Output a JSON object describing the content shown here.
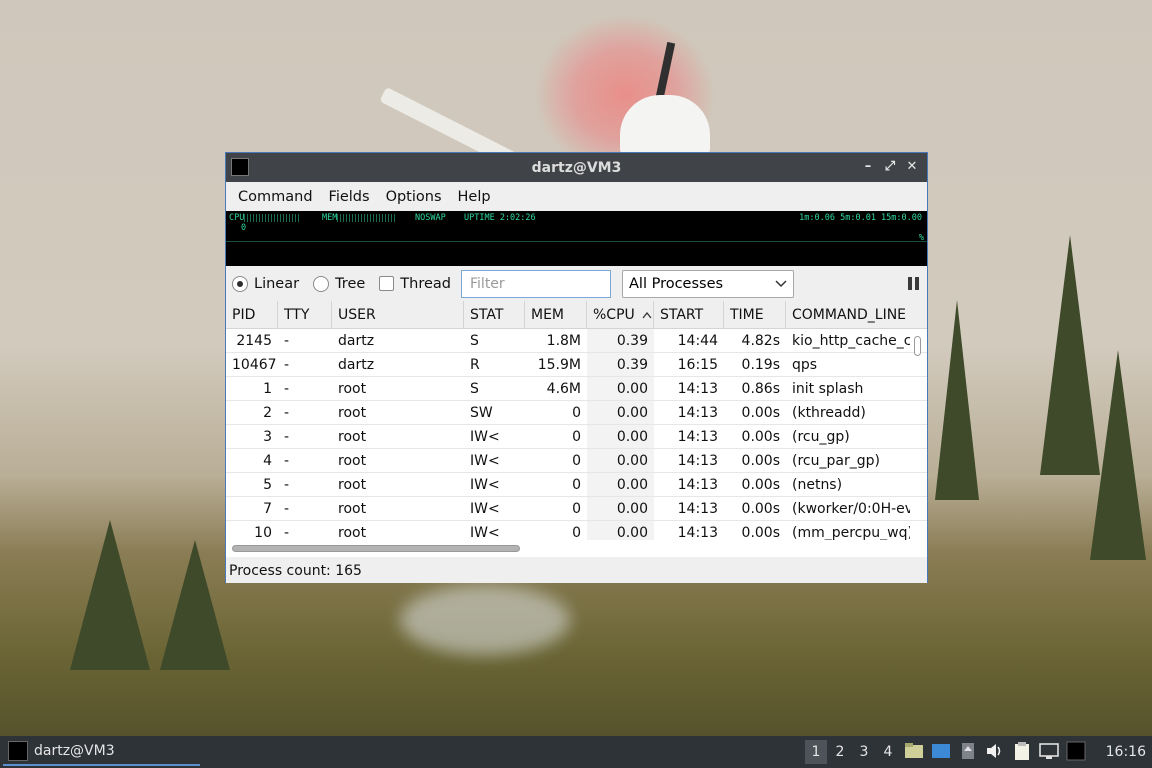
{
  "window": {
    "title": "dartz@VM3",
    "controls": {
      "minimize": "–",
      "maximize": "⤢",
      "close": "✕"
    }
  },
  "menu": [
    "Command",
    "Fields",
    "Options",
    "Help"
  ],
  "monitor": {
    "cpu_label": "CPU",
    "mem_label": "MEM",
    "swap_label": "NOSWAP",
    "uptime": "UPTIME 2:02:26",
    "load": "1m:0.06 5m:0.01 15m:0.00",
    "zero": "0",
    "pct": "%"
  },
  "view_modes": {
    "linear": "Linear",
    "tree": "Tree",
    "thread": "Thread",
    "selected": "linear"
  },
  "filter": {
    "placeholder": "Filter",
    "value": ""
  },
  "process_select": {
    "value": "All Processes"
  },
  "table": {
    "columns": [
      "PID",
      "TTY",
      "USER",
      "STAT",
      "MEM",
      "%CPU",
      "START",
      "TIME",
      "COMMAND_LINE"
    ],
    "sort_column": "%CPU",
    "rows": [
      [
        "2145",
        "-",
        "dartz",
        "S",
        "1.8M",
        "0.39",
        "14:44",
        "4.82s",
        "kio_http_cache_c"
      ],
      [
        "10467",
        "-",
        "dartz",
        "R",
        "15.9M",
        "0.39",
        "16:15",
        "0.19s",
        "qps"
      ],
      [
        "1",
        "-",
        "root",
        "S",
        "4.6M",
        "0.00",
        "14:13",
        "0.86s",
        "init splash"
      ],
      [
        "2",
        "-",
        "root",
        "SW",
        "0",
        "0.00",
        "14:13",
        "0.00s",
        "(kthreadd)"
      ],
      [
        "3",
        "-",
        "root",
        "IW<",
        "0",
        "0.00",
        "14:13",
        "0.00s",
        "(rcu_gp)"
      ],
      [
        "4",
        "-",
        "root",
        "IW<",
        "0",
        "0.00",
        "14:13",
        "0.00s",
        "(rcu_par_gp)"
      ],
      [
        "5",
        "-",
        "root",
        "IW<",
        "0",
        "0.00",
        "14:13",
        "0.00s",
        "(netns)"
      ],
      [
        "7",
        "-",
        "root",
        "IW<",
        "0",
        "0.00",
        "14:13",
        "0.00s",
        "(kworker/0:0H-ev"
      ],
      [
        "10",
        "-",
        "root",
        "IW<",
        "0",
        "0.00",
        "14:13",
        "0.00s",
        "(mm_percpu_wq)"
      ]
    ]
  },
  "status": {
    "text": "Process count: 165"
  },
  "taskbar": {
    "task_label": "dartz@VM3",
    "desktops": [
      "1",
      "2",
      "3",
      "4"
    ],
    "active_desktop": "1",
    "clock": "16:16"
  },
  "colors": {
    "accent": "#4a78b8",
    "titlebar": "#404347",
    "monitor_text": "#2fd7a0",
    "taskbar": "#2e3338"
  }
}
